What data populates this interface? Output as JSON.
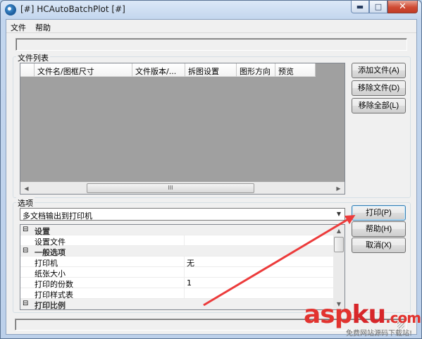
{
  "window": {
    "title": "[#] HCAutoBatchPlot [#]",
    "caption": {
      "minimize": "▬",
      "maximize": "□",
      "close": "✕"
    }
  },
  "menu": {
    "file": "文件",
    "help": "帮助"
  },
  "file_list": {
    "group_label": "文件列表",
    "columns": [
      "文件名/图框尺寸",
      "文件版本/...",
      "拆图设置",
      "图形方向",
      "预览"
    ],
    "scroll_thumb_glyph": "III",
    "buttons": {
      "add": "添加文件(A)",
      "remove": "移除文件(D)",
      "remove_all": "移除全部(L)"
    }
  },
  "options": {
    "group_label": "选项",
    "mode_selected": "多文档输出到打印机",
    "buttons": {
      "print": "打印(P)",
      "help": "帮助(H)",
      "cancel": "取消(X)"
    },
    "rows": [
      {
        "kind": "category",
        "toggle": "⊟",
        "name": "设置"
      },
      {
        "kind": "property",
        "name": "设置文件",
        "value": ""
      },
      {
        "kind": "category",
        "toggle": "⊟",
        "name": "一般选项"
      },
      {
        "kind": "property",
        "name": "打印机",
        "value": "无"
      },
      {
        "kind": "property",
        "name": "纸张大小",
        "value": ""
      },
      {
        "kind": "property",
        "name": "打印的份数",
        "value": "1"
      },
      {
        "kind": "property",
        "name": "打印样式表",
        "value": ""
      },
      {
        "kind": "category",
        "toggle": "⊟",
        "name": "打印比例"
      }
    ]
  },
  "watermark": {
    "brand_a": "asp",
    "brand_b": "ku",
    "brand_c": ".com",
    "sub": "免费网站源码下载站!"
  },
  "colors": {
    "annotation_arrow": "#ec3b3b",
    "watermark_red": "#e2332f"
  }
}
